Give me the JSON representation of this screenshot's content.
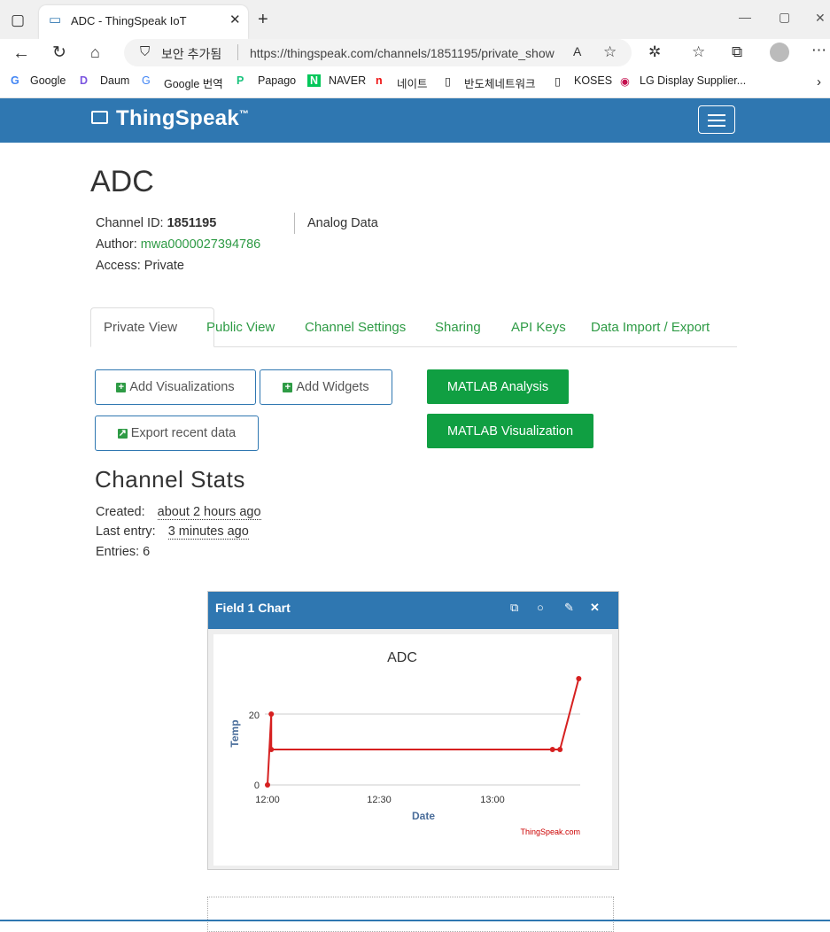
{
  "browser": {
    "tab_title": "ADC - ThingSpeak IoT",
    "security_label": "보안 추가됨",
    "url": "https://thingspeak.com/channels/1851195/private_show",
    "bookmarks": [
      "Google",
      "Daum",
      "Google 번역",
      "Papago",
      "NAVER",
      "네이트",
      "반도체네트워크",
      "KOSES",
      "LG Display Supplier..."
    ]
  },
  "navbar": {
    "brand": "ThingSpeak",
    "tm": "™"
  },
  "channel": {
    "name": "ADC",
    "id_label": "Channel ID:",
    "id": "1851195",
    "author_label": "Author:",
    "author": "mwa0000027394786",
    "access": "Access: Private",
    "description": "Analog Data"
  },
  "tabs": [
    "Private View",
    "Public View",
    "Channel Settings",
    "Sharing",
    "API Keys",
    "Data Import / Export"
  ],
  "buttons": {
    "add_visualizations": "Add Visualizations",
    "add_widgets": "Add Widgets",
    "export_recent": "Export recent data",
    "matlab_analysis": "MATLAB Analysis",
    "matlab_visualization": "MATLAB Visualization"
  },
  "stats": {
    "title": "Channel Stats",
    "created_label": "Created:",
    "created": "about 2 hours ago",
    "last_entry_label": "Last entry:",
    "last_entry": "3 minutes ago",
    "entries": "Entries: 6"
  },
  "widget": {
    "title": "Field 1 Chart"
  },
  "chart_data": {
    "type": "line",
    "title": "ADC",
    "xlabel": "Date",
    "ylabel": "Temp",
    "credit": "ThingSpeak.com",
    "x_ticks": [
      "12:00",
      "12:30",
      "13:00"
    ],
    "y_ticks": [
      0,
      20
    ],
    "ylim": [
      0,
      30
    ],
    "color": "#d62020",
    "points": [
      {
        "x": "12:00",
        "y": 0
      },
      {
        "x": "12:01",
        "y": 20
      },
      {
        "x": "12:01",
        "y": 10
      },
      {
        "x": "13:16",
        "y": 10
      },
      {
        "x": "13:18",
        "y": 10
      },
      {
        "x": "13:23",
        "y": 30
      }
    ]
  }
}
